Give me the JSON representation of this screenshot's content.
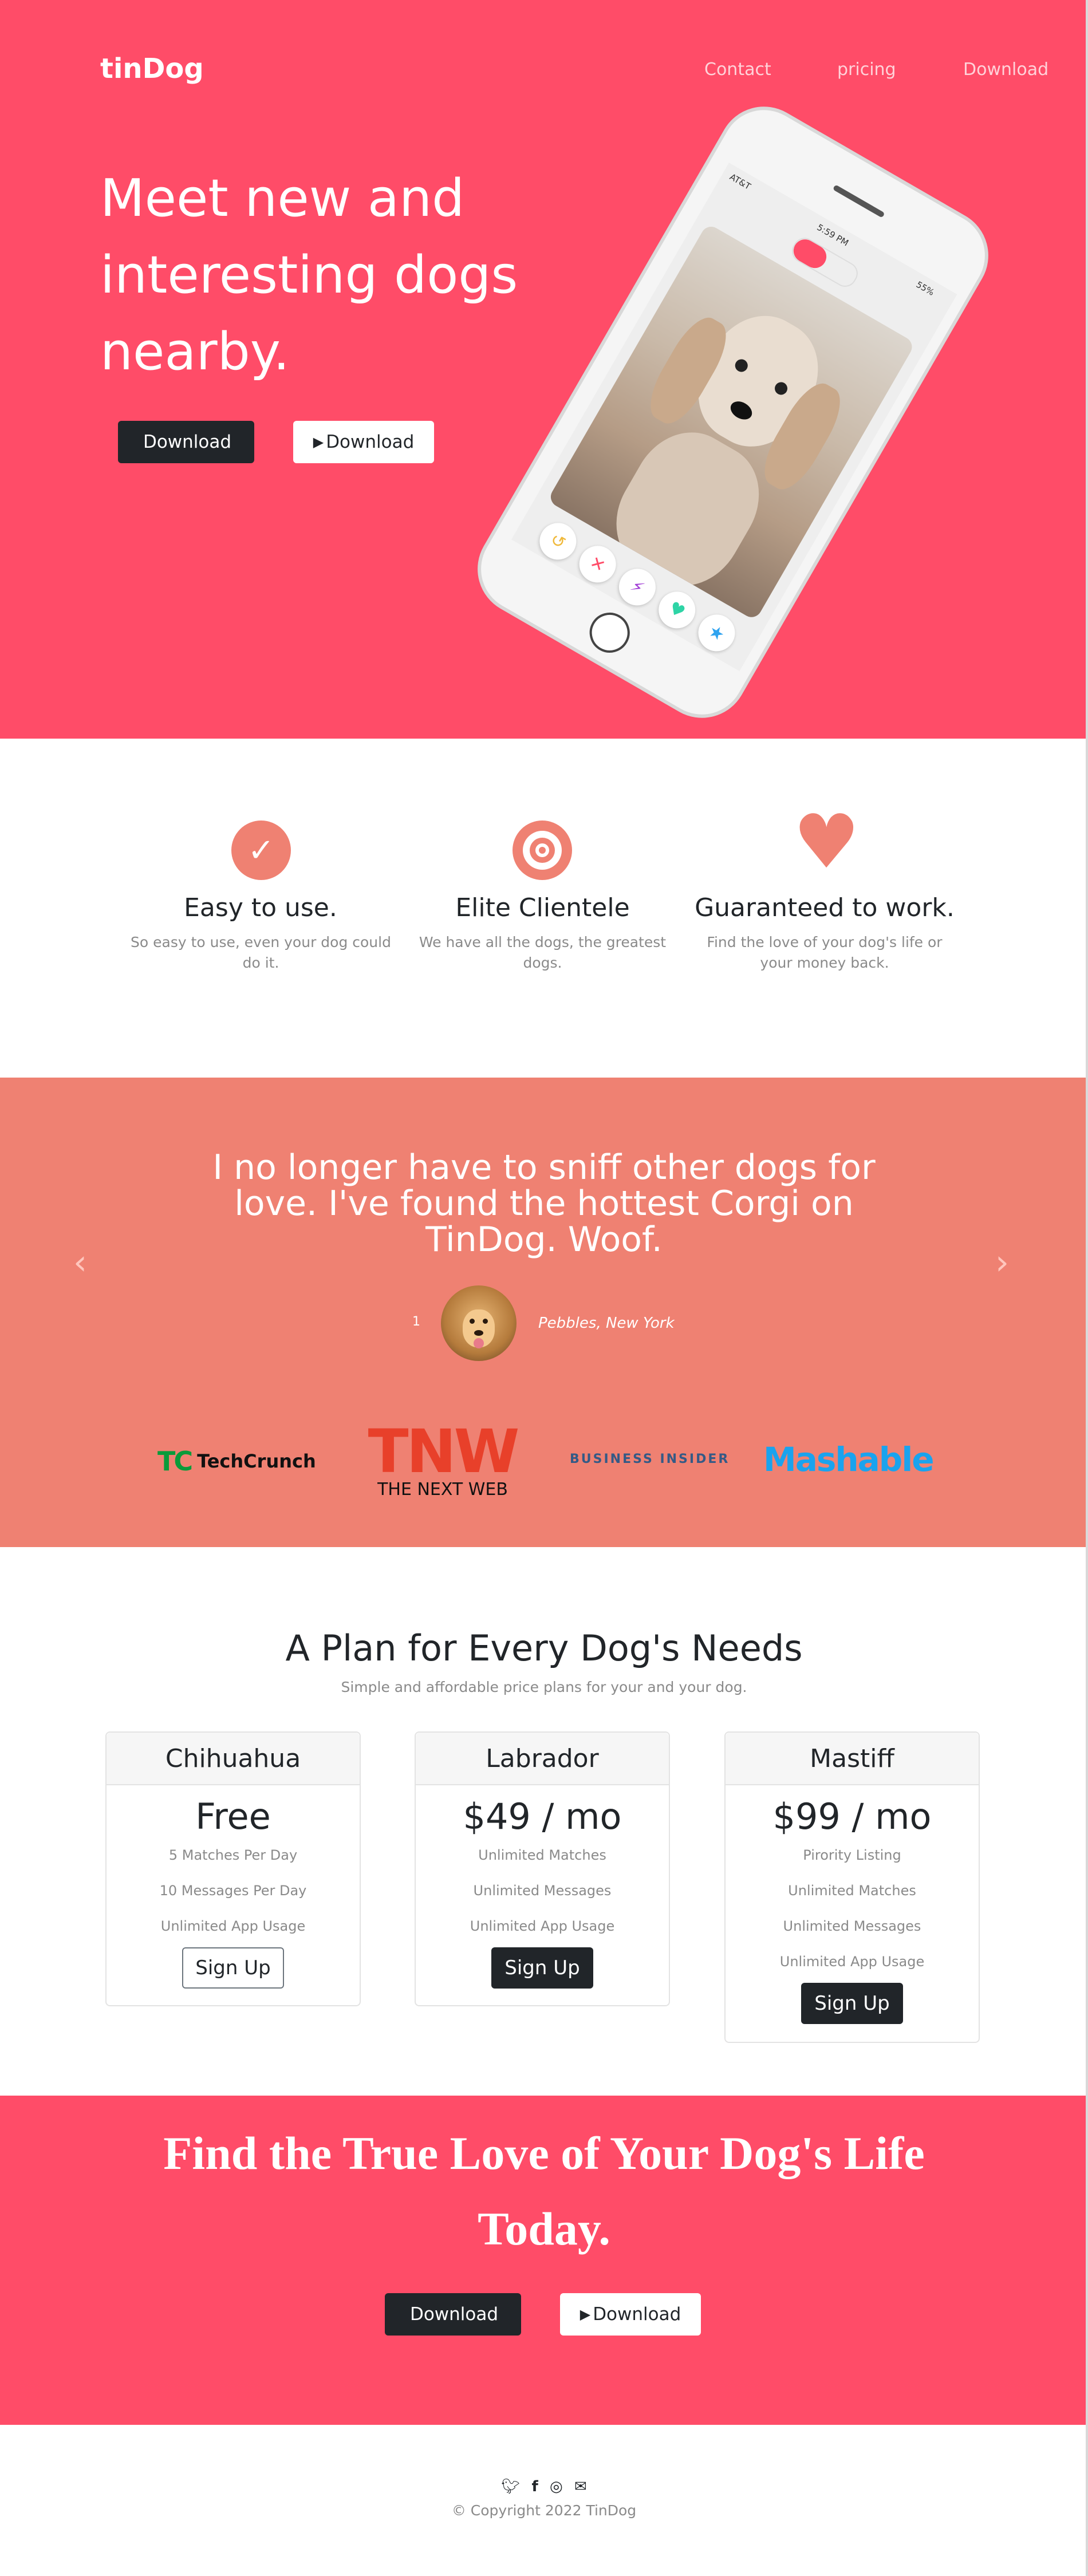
{
  "nav": {
    "brand": "tinDog",
    "links": [
      "Contact",
      "pricing",
      "Download"
    ]
  },
  "hero": {
    "title": "Meet new and interesting dogs nearby.",
    "buttons": [
      {
        "icon": "apple-icon",
        "glyph": "",
        "label": "Download"
      },
      {
        "icon": "google-play-icon",
        "glyph": "▶",
        "label": "Download"
      }
    ],
    "phone": {
      "carrier": "AT&T",
      "time": "5:59 PM",
      "battery": "55%"
    }
  },
  "features": [
    {
      "icon": "check-circle-icon",
      "title": "Easy to use.",
      "text": "So easy to use, even your dog could do it."
    },
    {
      "icon": "bullseye-icon",
      "title": "Elite Clientele",
      "text": "We have all the dogs, the greatest dogs."
    },
    {
      "icon": "heart-icon",
      "title": "Guaranteed to work.",
      "text": "Find the love of your dog's life or your money back."
    }
  ],
  "testimonial": {
    "quote": "I no longer have to sniff other dogs for love. I've found the hottest Corgi on TinDog. Woof.",
    "slide_number": "1",
    "author": "Pebbles, New York",
    "prev": "‹",
    "next": "›"
  },
  "press": {
    "techcrunch": {
      "mark": "TC",
      "name": "TechCrunch"
    },
    "tnw": {
      "mark": "TNW",
      "name": "THE NEXT WEB"
    },
    "business_insider": "BUSINESS INSIDER",
    "mashable": "Mashable"
  },
  "pricing": {
    "title": "A Plan for Every Dog's Needs",
    "subtitle": "Simple and affordable price plans for your and your dog.",
    "plans": [
      {
        "name": "Chihuahua",
        "price": "Free",
        "features": [
          "5 Matches Per Day",
          "10 Messages Per Day",
          "Unlimited App Usage"
        ],
        "button": "Sign Up"
      },
      {
        "name": "Labrador",
        "price": "$49 / mo",
        "features": [
          "Unlimited Matches",
          "Unlimited Messages",
          "Unlimited App Usage"
        ],
        "button": "Sign Up"
      },
      {
        "name": "Mastiff",
        "price": "$99 / mo",
        "features": [
          "Pirority Listing",
          "Unlimited Matches",
          "Unlimited Messages",
          "Unlimited App Usage"
        ],
        "button": "Sign Up"
      }
    ]
  },
  "cta": {
    "title": "Find the True Love of Your Dog's Life Today.",
    "buttons": [
      {
        "icon": "apple-icon",
        "glyph": "",
        "label": "Download"
      },
      {
        "icon": "google-play-icon",
        "glyph": "▶",
        "label": "Download"
      }
    ]
  },
  "footer": {
    "social": [
      "twitter-icon",
      "facebook-icon",
      "instagram-icon",
      "envelope-icon"
    ],
    "copyright": "© Copyright 2022 TinDog"
  },
  "colors": {
    "primary": "#ff4c68",
    "secondary": "#ef8172",
    "dark": "#212529"
  }
}
